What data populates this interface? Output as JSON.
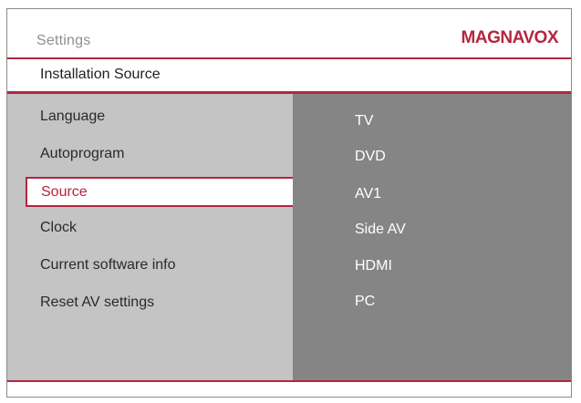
{
  "header": {
    "title": "Settings",
    "brand": "MAGNAVOX"
  },
  "subheader": {
    "label": "Installation Source"
  },
  "menu": {
    "items": [
      {
        "label": "Language"
      },
      {
        "label": "Autoprogram"
      },
      {
        "label": "Source"
      },
      {
        "label": "Clock"
      },
      {
        "label": "Current software info"
      },
      {
        "label": "Reset AV settings"
      }
    ],
    "selected": "Source"
  },
  "options": {
    "items": [
      {
        "label": "TV"
      },
      {
        "label": "DVD"
      },
      {
        "label": "AV1"
      },
      {
        "label": "Side AV"
      },
      {
        "label": "HDMI"
      },
      {
        "label": "PC"
      }
    ]
  },
  "colors": {
    "accent": "#b5263e",
    "menu_panel": "#c4c4c4",
    "options_panel": "#858585"
  }
}
